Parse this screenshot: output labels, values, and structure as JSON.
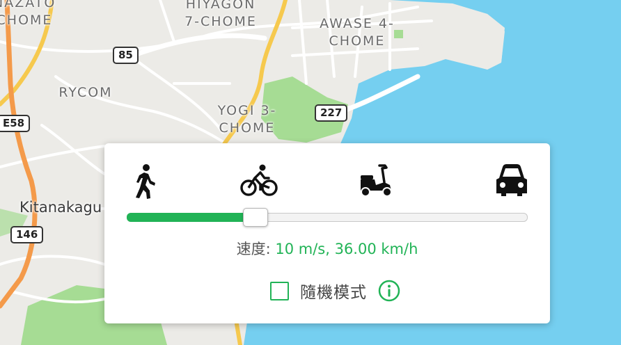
{
  "map": {
    "labels": [
      {
        "id": "nazato",
        "text": "NAZATO\nCHOME"
      },
      {
        "id": "hiyagon",
        "text": "HIYAGON\n7-CHOME"
      },
      {
        "id": "awase",
        "text": "AWASE 4-\nCHOME"
      },
      {
        "id": "rycom",
        "text": "RYCOM"
      },
      {
        "id": "yogi",
        "text": "YOGI 3-\nCHOME"
      },
      {
        "id": "kitanakagusuku",
        "text": "Kitanakagu"
      }
    ],
    "shields": [
      {
        "id": "route-85",
        "text": "85"
      },
      {
        "id": "route-227",
        "text": "227"
      },
      {
        "id": "route-e58",
        "text": "E58"
      },
      {
        "id": "route-146",
        "text": "146"
      }
    ],
    "colors": {
      "land": "#ecebe7",
      "sea": "#75cff0",
      "park": "#a6dc94",
      "road_major": "#f6c94e",
      "expressway": "#f49a4a"
    }
  },
  "panel": {
    "modes": [
      {
        "id": "walk",
        "icon": "walking-person-icon"
      },
      {
        "id": "bike",
        "icon": "bicycle-icon"
      },
      {
        "id": "scooter",
        "icon": "scooter-icon"
      },
      {
        "id": "car",
        "icon": "car-icon"
      }
    ],
    "slider": {
      "fraction": 0.32,
      "active_color": "#21b356"
    },
    "speed": {
      "label": "速度:",
      "value": " 10 m/s, 36.00 km/h"
    },
    "random_mode": {
      "label": "隨機模式",
      "checked": false,
      "info_icon": "info-icon"
    }
  }
}
